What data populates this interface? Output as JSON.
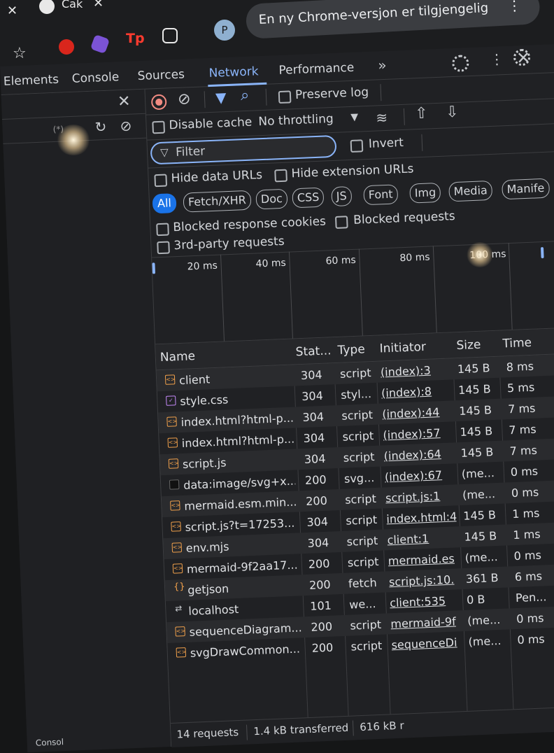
{
  "browser": {
    "tab_title": "Cak",
    "update_banner": "En ny Chrome-versjon er tilgjengelig",
    "avatar_letter": "P",
    "ext_tp": "Tp"
  },
  "devtools": {
    "tabs": [
      "Elements",
      "Console",
      "Sources",
      "Network",
      "Performance"
    ],
    "active_tab": "Network",
    "more_tabs": "»"
  },
  "network": {
    "preserve_log": "Preserve log",
    "disable_cache": "Disable cache",
    "throttling": "No throttling",
    "filter_placeholder": "Filter",
    "invert": "Invert",
    "hide_data_urls": "Hide data URLs",
    "hide_extension_urls": "Hide extension URLs",
    "type_filters": [
      "All",
      "Fetch/XHR",
      "Doc",
      "CSS",
      "JS",
      "Font",
      "Img",
      "Media",
      "Manife"
    ],
    "active_filter": "All",
    "blocked_response_cookies": "Blocked response cookies",
    "blocked_requests": "Blocked requests",
    "third_party": "3rd-party requests",
    "timeline_labels": [
      "20 ms",
      "40 ms",
      "60 ms",
      "80 ms",
      "100 ms"
    ],
    "columns": [
      "Name",
      "Stat...",
      "Type",
      "Initiator",
      "Size",
      "Time"
    ],
    "rows": [
      {
        "name": "client",
        "status": "304",
        "type": "script",
        "initiator": "(index):3",
        "size": "145 B",
        "time": "8 ms",
        "icon": "script"
      },
      {
        "name": "style.css",
        "status": "304",
        "type": "styl...",
        "initiator": "(index):8",
        "size": "145 B",
        "time": "5 ms",
        "icon": "css"
      },
      {
        "name": "index.html?html-p...",
        "status": "304",
        "type": "script",
        "initiator": "(index):44",
        "size": "145 B",
        "time": "7 ms",
        "icon": "script"
      },
      {
        "name": "index.html?html-p...",
        "status": "304",
        "type": "script",
        "initiator": "(index):57",
        "size": "145 B",
        "time": "7 ms",
        "icon": "script"
      },
      {
        "name": "script.js",
        "status": "304",
        "type": "script",
        "initiator": "(index):64",
        "size": "145 B",
        "time": "7 ms",
        "icon": "script"
      },
      {
        "name": "data:image/svg+x...",
        "status": "200",
        "type": "svg...",
        "initiator": "(index):67",
        "size": "(me...",
        "time": "0 ms",
        "icon": "img"
      },
      {
        "name": "mermaid.esm.min...",
        "status": "200",
        "type": "script",
        "initiator": "script.js:1",
        "size": "(me...",
        "time": "0 ms",
        "icon": "script"
      },
      {
        "name": "script.js?t=17253...",
        "status": "304",
        "type": "script",
        "initiator": "index.html:4",
        "size": "145 B",
        "time": "1 ms",
        "icon": "script"
      },
      {
        "name": "env.mjs",
        "status": "304",
        "type": "script",
        "initiator": "client:1",
        "size": "145 B",
        "time": "1 ms",
        "icon": "script"
      },
      {
        "name": "mermaid-9f2aa17...",
        "status": "200",
        "type": "script",
        "initiator": "mermaid.es",
        "size": "(me...",
        "time": "0 ms",
        "icon": "script"
      },
      {
        "name": "getjson",
        "status": "200",
        "type": "fetch",
        "initiator": "script.js:10.",
        "size": "361 B",
        "time": "6 ms",
        "icon": "fetch"
      },
      {
        "name": "localhost",
        "status": "101",
        "type": "we...",
        "initiator": "client:535",
        "size": "0 B",
        "time": "Pen...",
        "icon": "ws"
      },
      {
        "name": "sequenceDiagram...",
        "status": "200",
        "type": "script",
        "initiator": "mermaid-9f",
        "size": "(me...",
        "time": "0 ms",
        "icon": "script"
      },
      {
        "name": "svgDrawCommon...",
        "status": "200",
        "type": "script",
        "initiator": "sequenceDi",
        "size": "(me...",
        "time": "0 ms",
        "icon": "script"
      }
    ],
    "status": {
      "requests": "14 requests",
      "transferred": "1.4 kB transferred",
      "resources": "616 kB r"
    }
  },
  "left_panel": {
    "star_label": "(*)",
    "status": "Consol"
  }
}
